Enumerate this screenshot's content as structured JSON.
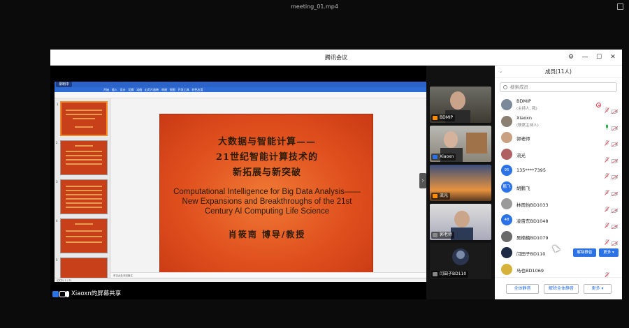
{
  "player": {
    "title": "meeting_01.mp4"
  },
  "window": {
    "title": "腾讯会议",
    "controls": [
      "⚙",
      "—",
      "☐",
      "✕"
    ]
  },
  "ppt": {
    "recording_label": "录制中",
    "ribbon_tabs": [
      "开始",
      "插入",
      "设计",
      "切换",
      "动画",
      "幻灯片放映",
      "审阅",
      "视图",
      "开发工具",
      "特色应用"
    ],
    "status_text": "幻灯片 1 / 31",
    "notes_placeholder": "单击此处添加备注",
    "slide": {
      "zh_line1": "大数据与智能计算——",
      "zh_line2": "21世纪智能计算技术的",
      "zh_line3": "新拓展与新突破",
      "en_line1": "Computational Intelligence for Big Data Analysis——",
      "en_line2": "New Expansions and Breakthroughs of the 21st",
      "en_line3": "Century AI Computing Life Science",
      "author": "肖筱南 博导/教授"
    },
    "thumbnails": [
      {
        "number": "1"
      },
      {
        "number": "2"
      },
      {
        "number": "3"
      },
      {
        "number": "4"
      },
      {
        "number": "5"
      }
    ]
  },
  "share_bar": {
    "label": "Xiaoxn的屏幕共享"
  },
  "videos": [
    {
      "name": "BDMIP"
    },
    {
      "name": "Xiaoxn"
    },
    {
      "name": "流光"
    },
    {
      "name": "郭老师"
    },
    {
      "name": "闫田子BD110"
    }
  ],
  "panel": {
    "title": "成员(11人)",
    "search_placeholder": "搜索成员",
    "members": [
      {
        "name": "BDMIP",
        "sub": "(主持人, 我)",
        "avatar_text": "",
        "avatar_color": "#7a8a9a"
      },
      {
        "name": "Xiaoxn",
        "sub": "(联席主持人)",
        "avatar_text": "",
        "avatar_color": "#8a7f70"
      },
      {
        "name": "郭老师",
        "sub": "",
        "avatar_text": "",
        "avatar_color": "#c9a080"
      },
      {
        "name": "流光",
        "sub": "",
        "avatar_text": "",
        "avatar_color": "#b06060"
      },
      {
        "name": "135****7395",
        "sub": "",
        "avatar_text": "95",
        "avatar_color": "#2a72e6"
      },
      {
        "name": "胡鹏飞",
        "sub": "",
        "avatar_text": "鹏飞",
        "avatar_color": "#2a72e6"
      },
      {
        "name": "林雨怡BD1033",
        "sub": "",
        "avatar_text": "",
        "avatar_color": "#9a9a9a"
      },
      {
        "name": "凌宙东BD1048",
        "sub": "",
        "avatar_text": "48",
        "avatar_color": "#2a72e6"
      },
      {
        "name": "吴楠楠BD1079",
        "sub": "",
        "avatar_text": "",
        "avatar_color": "#6a6a6a"
      },
      {
        "name": "闫田子BD110",
        "sub": "",
        "avatar_text": "",
        "avatar_color": "#1d2a44"
      },
      {
        "name": "马也BD1069",
        "sub": "",
        "avatar_text": "",
        "avatar_color": "#d6b23a"
      }
    ],
    "row_unmute_label": "解除静音",
    "row_more_label": "更多 ▾",
    "footer": {
      "mute_all": "全体静音",
      "unmute_all": "解除全体静音",
      "more": "更多 ▾"
    }
  }
}
